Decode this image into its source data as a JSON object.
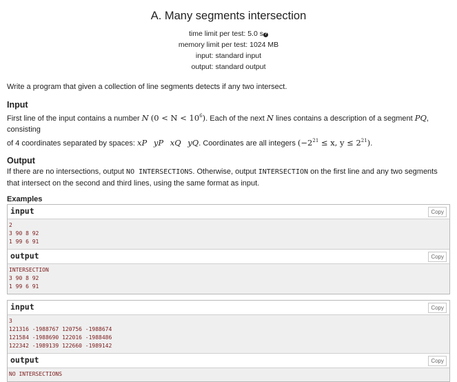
{
  "problem": {
    "title": "A. Many segments intersection",
    "time_limit_label": "time limit per test:",
    "time_limit_value": "5.0 s",
    "memory_limit_label": "memory limit per test:",
    "memory_limit_value": "1024 MB",
    "input_label": "input:",
    "input_value": "standard input",
    "output_label": "output:",
    "output_value": "standard output"
  },
  "legend": "Write a program that given a collection of line segments detects if any two intersect.",
  "input_section": {
    "title": "Input",
    "text_1": "First line of the input contains a number ",
    "math_n": "N",
    "math_range": "(0 < N < 10",
    "math_range_exp": "6",
    "math_range_end": ")",
    "text_2": ". Each of the next ",
    "math_n2": "N",
    "text_3": " lines contains a description of a segment ",
    "math_pq": "PQ",
    "text_4": ", consisting",
    "text_5": "of 4 coordinates separated by spaces: ",
    "coords": "xP  yP  xQ  yQ",
    "text_6": ". Coordinates are all integers ",
    "bounds": "(−2",
    "bounds_exp1": "21",
    "bounds_mid": " ≤ x, y ≤ 2",
    "bounds_exp2": "21",
    "bounds_end": ")",
    "text_7": "."
  },
  "output_section": {
    "title": "Output",
    "text_1": "If there are no intersections, output ",
    "code_1": "NO INTERSECTIONS",
    "text_2": ". Otherwise, output ",
    "code_2": "INTERSECTION",
    "text_3": " on the first line and any two segments",
    "text_4": "that intersect on the second and third lines, using the same format as input."
  },
  "examples": {
    "title": "Examples",
    "copy_label": "Copy",
    "input_label": "input",
    "output_label": "output",
    "tests": [
      {
        "input": [
          "2",
          "3 90 8 92",
          "1 99 6 91"
        ],
        "output": [
          "INTERSECTION",
          "3 90 8 92",
          "1 99 6 91"
        ]
      },
      {
        "input": [
          "3",
          "121316 -1988767 120756 -1988674",
          "121584 -1988690 122016 -1988486",
          "122342 -1989139 122660 -1989142"
        ],
        "output": [
          "NO INTERSECTIONS"
        ]
      }
    ]
  }
}
